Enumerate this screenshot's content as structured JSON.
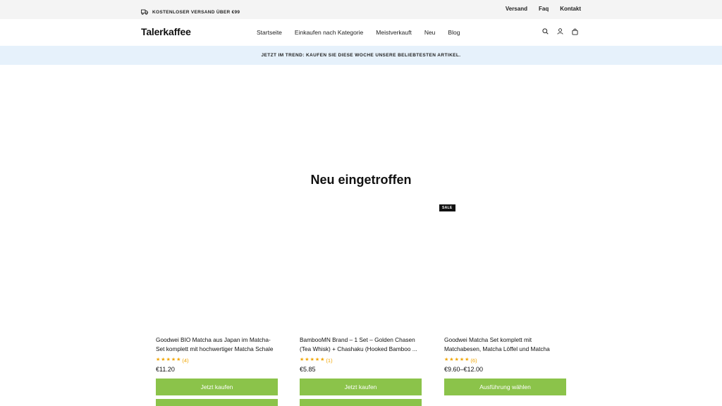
{
  "topbar": {
    "shipping_text": "KOSTENLOSER VERSAND ÜBER €99",
    "links": [
      "Versand",
      "Faq",
      "Kontakt"
    ]
  },
  "header": {
    "logo": "Talerkaffee",
    "nav": [
      "Startseite",
      "Einkaufen nach Kategorie",
      "Meistverkauft",
      "Neu",
      "Blog"
    ],
    "icons": [
      "search-icon",
      "account-icon",
      "bag-icon"
    ]
  },
  "banner": {
    "text": "JETZT IM TREND: KAUFEN SIE DIESE WOCHE UNSERE BELIEBTESTEN ARTIKEL."
  },
  "section": {
    "title": "Neu eingetroffen"
  },
  "products": [
    {
      "name": "Goodwei BIO Matcha aus Japan im Matcha-Set komplett mit hochwertiger Matcha Schale ...",
      "rating": 5,
      "reviews": "(4)",
      "price": "€11.20",
      "button": "Jetzt kaufen",
      "badge": ""
    },
    {
      "name": "BambooMN Brand – 1 Set – Golden Chasen (Tea Whisk) + Chashaku (Hooked Bamboo ...",
      "rating": 5,
      "reviews": "(1)",
      "price": "€5.85",
      "button": "Jetzt kaufen",
      "badge": ""
    },
    {
      "name": "Goodwei Matcha Set komplett mit Matchabesen, Matcha Löffel und Matcha Schale aus K...",
      "rating": 5,
      "reviews": "(6)",
      "price": "€9.60–€12.00",
      "button": "Ausführung wählen",
      "badge": "SALE"
    }
  ],
  "colors": {
    "button_green": "#8bc34a",
    "star_color": "#f0a500",
    "banner_bg": "#e6f1fb",
    "topbar_bg": "#f4f4f4"
  }
}
